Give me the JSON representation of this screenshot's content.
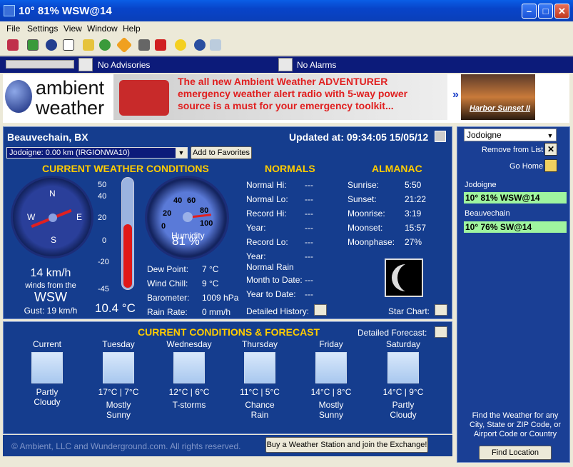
{
  "window": {
    "title": "10° 81% WSW@14"
  },
  "menu": [
    "File",
    "Settings",
    "View",
    "Window",
    "Help"
  ],
  "advisories": {
    "advisory_text": "No Advisories",
    "alarm_text": "No Alarms"
  },
  "banner": {
    "logo_line1": "ambient",
    "logo_line2": "weather",
    "ad_text": "The all new Ambient Weather ADVENTURER emergency weather alert radio with 5-way power source is a must for your emergency toolkit...",
    "next_symbol": "»",
    "photo_caption": "Harbor Sunset II"
  },
  "location": {
    "name": "Beauvechain, BX",
    "updated": "Updated at: 09:34:05 15/05/12",
    "station_select": "Jodoigne:  0.00 km (IRGIONWA10)",
    "add_favorites": "Add to Favorites"
  },
  "current": {
    "heading": "CURRENT WEATHER CONDITIONS",
    "compass": {
      "n": "N",
      "e": "E",
      "s": "S",
      "w": "W"
    },
    "wind_speed": "14 km/h",
    "wind_from_label": "winds from the",
    "wind_dir": "WSW",
    "gust": "Gust:  19 km/h",
    "thermo_ticks": [
      "50",
      "40",
      "20",
      "0",
      "-20",
      "-45"
    ],
    "temperature": "10.4 °C",
    "temperature_value": 10.4,
    "hum_ticks": [
      "20",
      "40",
      "60",
      "80",
      "100",
      "0"
    ],
    "humidity_label": "Humidity",
    "humidity": "81 %",
    "humidity_value": 81
  },
  "details": [
    {
      "label": "Dew Point:",
      "value": "7 °C"
    },
    {
      "label": "Wind Chill:",
      "value": "9 °C"
    },
    {
      "label": "Barometer:",
      "value": "1009 hPa"
    },
    {
      "label": "Rain Rate:",
      "value": "0 mm/h"
    }
  ],
  "normals": {
    "heading": "NORMALS",
    "rows": [
      {
        "label": "Normal Hi:",
        "value": "---"
      },
      {
        "label": "Normal Lo:",
        "value": "---"
      },
      {
        "label": "Record Hi:",
        "value": "---"
      },
      {
        "label": "Year:",
        "value": "---"
      },
      {
        "label": "Record Lo:",
        "value": "---"
      },
      {
        "label": "Year:",
        "value": "---"
      }
    ],
    "normal_rain_label": "Normal Rain",
    "rain_rows": [
      {
        "label": "Month to Date:",
        "value": "---"
      },
      {
        "label": "Year to Date:",
        "value": "---"
      }
    ],
    "history_label": "Detailed History:"
  },
  "almanac": {
    "heading": "ALMANAC",
    "rows": [
      {
        "label": "Sunrise:",
        "value": "5:50"
      },
      {
        "label": "Sunset:",
        "value": "21:22"
      },
      {
        "label": "Moonrise:",
        "value": "3:19"
      },
      {
        "label": "Moonset:",
        "value": "15:57"
      },
      {
        "label": "Moonphase:",
        "value": "27%"
      }
    ],
    "star_chart_label": "Star Chart:"
  },
  "forecast": {
    "heading": "CURRENT CONDITIONS & FORECAST",
    "detail_label": "Detailed Forecast:",
    "days": [
      {
        "day": "Current",
        "temps": "",
        "cond1": "Partly",
        "cond2": "Cloudy",
        "icon": "partly-cloudy-icon"
      },
      {
        "day": "Tuesday",
        "temps": "17°C | 7°C",
        "cond1": "Mostly",
        "cond2": "Sunny",
        "icon": "partly-cloudy-icon"
      },
      {
        "day": "Wednesday",
        "temps": "12°C | 6°C",
        "cond1": "T-storms",
        "cond2": "",
        "icon": "tstorm-icon"
      },
      {
        "day": "Thursday",
        "temps": "11°C | 5°C",
        "cond1": "Chance",
        "cond2": "Rain",
        "icon": "rain-icon"
      },
      {
        "day": "Friday",
        "temps": "14°C | 8°C",
        "cond1": "Mostly",
        "cond2": "Sunny",
        "icon": "partly-cloudy-icon"
      },
      {
        "day": "Saturday",
        "temps": "14°C | 9°C",
        "cond1": "Partly",
        "cond2": "Cloudy",
        "icon": "partly-cloudy-icon"
      }
    ]
  },
  "footer": {
    "copyright": "© Ambient, LLC and Wunderground.com. All rights reserved.",
    "buy_button": "Buy a Weather Station and join the Exchange!"
  },
  "sidebar": {
    "location_select": "Jodoigne",
    "remove_label": "Remove from List",
    "home_label": "Go Home",
    "favorites": [
      {
        "name": "Jodoigne",
        "summary": "10° 81% WSW@14"
      },
      {
        "name": "Beauvechain",
        "summary": "10° 76% SW@14"
      }
    ],
    "find_text": "Find the Weather for any City, State or ZIP Code, or Airport Code or Country",
    "find_button": "Find Location"
  },
  "colors": {
    "panel_bg": "#153d8e",
    "heading_yellow": "#ffcc00",
    "fav_green": "#9ff59f",
    "title_blue": "#0a5ee6"
  }
}
